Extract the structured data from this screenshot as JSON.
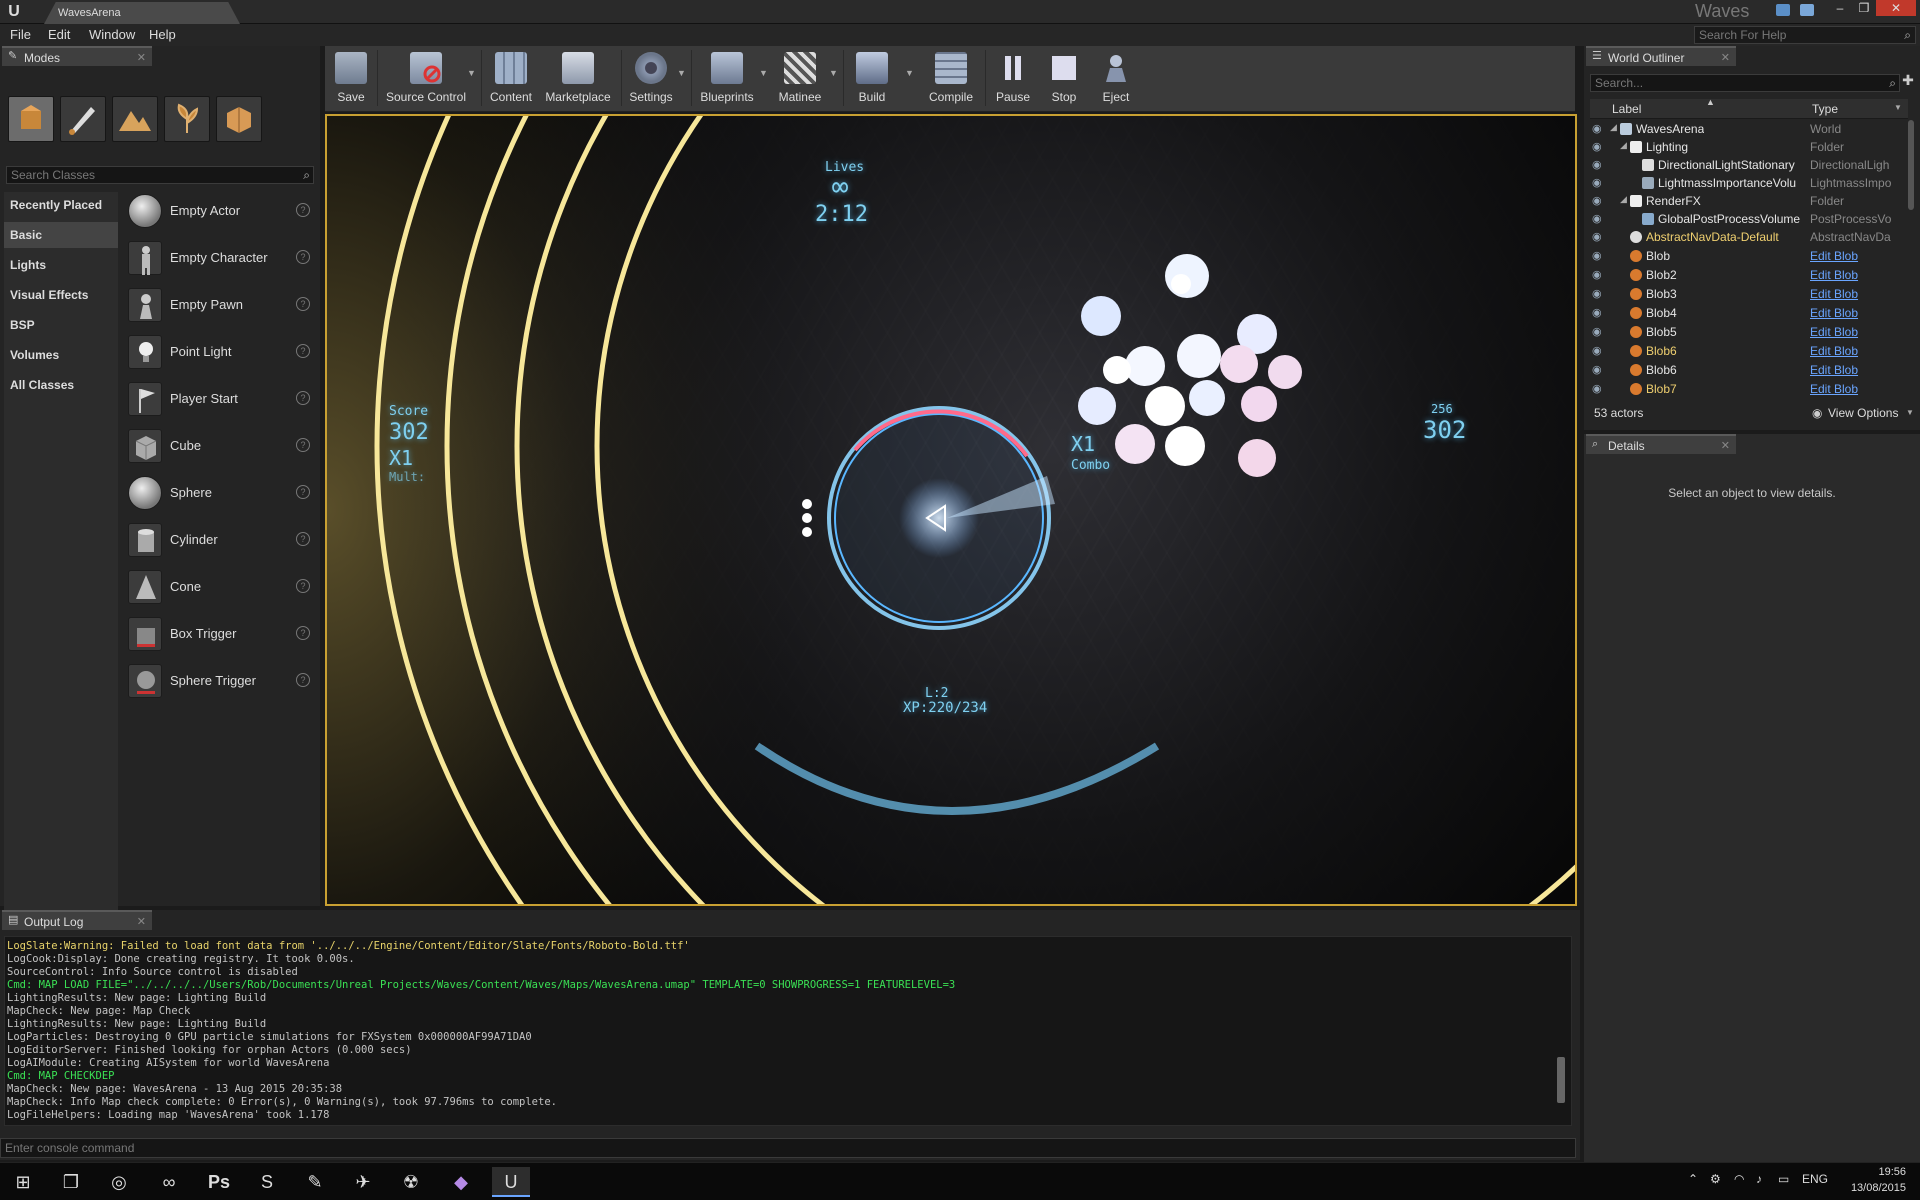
{
  "window": {
    "document_tab": "WavesArena",
    "app_title": "Waves",
    "search_help_placeholder": "Search For Help",
    "menu": [
      "File",
      "Edit",
      "Window",
      "Help"
    ]
  },
  "modes": {
    "tab_label": "Modes",
    "search_placeholder": "Search Classes",
    "categories": [
      "Recently Placed",
      "Basic",
      "Lights",
      "Visual Effects",
      "BSP",
      "Volumes",
      "All Classes"
    ],
    "active_category": "Basic",
    "classes": [
      "Empty Actor",
      "Empty Character",
      "Empty Pawn",
      "Point Light",
      "Player Start",
      "Cube",
      "Sphere",
      "Cylinder",
      "Cone",
      "Box Trigger",
      "Sphere Trigger"
    ]
  },
  "toolbar": {
    "buttons": [
      "Save",
      "Source Control",
      "Content",
      "Marketplace",
      "Settings",
      "Blueprints",
      "Matinee",
      "Build",
      "Compile",
      "Pause",
      "Stop",
      "Eject"
    ]
  },
  "game_hud": {
    "lives_label": "Lives",
    "lives_value": "∞",
    "timer": "2:12",
    "score_label": "Score",
    "score_value": "302",
    "multiplier": "X1",
    "mult_label": "Mult:",
    "combo_multiplier": "X1",
    "combo_label": "Combo",
    "right_small": "256",
    "right_score": "302",
    "level": "L:2",
    "xp": "XP:220/234"
  },
  "outliner": {
    "tab_label": "World Outliner",
    "search_placeholder": "Search...",
    "col_label": "Label",
    "col_type": "Type",
    "rows": [
      {
        "label": "WavesArena",
        "type": "World",
        "link": false
      },
      {
        "label": "Lighting",
        "type": "Folder",
        "link": false
      },
      {
        "label": "DirectionalLightStationary",
        "type": "DirectionalLigh",
        "link": false
      },
      {
        "label": "LightmassImportanceVolu",
        "type": "LightmassImpo",
        "link": false
      },
      {
        "label": "RenderFX",
        "type": "Folder",
        "link": false
      },
      {
        "label": "GlobalPostProcessVolume",
        "type": "PostProcessVo",
        "link": false
      },
      {
        "label": "AbstractNavData-Default",
        "type": "AbstractNavDa",
        "link": false
      },
      {
        "label": "Blob",
        "type": "Edit Blob",
        "link": true
      },
      {
        "label": "Blob2",
        "type": "Edit Blob",
        "link": true
      },
      {
        "label": "Blob3",
        "type": "Edit Blob",
        "link": true
      },
      {
        "label": "Blob4",
        "type": "Edit Blob",
        "link": true
      },
      {
        "label": "Blob5",
        "type": "Edit Blob",
        "link": true
      },
      {
        "label": "Blob6",
        "type": "Edit Blob",
        "link": true
      },
      {
        "label": "Blob6",
        "type": "Edit Blob",
        "link": true
      },
      {
        "label": "Blob7",
        "type": "Edit Blob",
        "link": true
      }
    ],
    "actor_count": "53 actors",
    "view_options": "View Options"
  },
  "details": {
    "tab_label": "Details",
    "empty_text": "Select an object to view details."
  },
  "output_log": {
    "tab_label": "Output Log",
    "lines": [
      {
        "text": "LogSlate:Warning: Failed to load font data from '../../../Engine/Content/Editor/Slate/Fonts/Roboto-Bold.ttf'",
        "kind": "warn"
      },
      {
        "text": "LogCook:Display: Done creating registry. It took  0.00s.",
        "kind": "normal"
      },
      {
        "text": "SourceControl: Info Source control is disabled",
        "kind": "normal"
      },
      {
        "text": "Cmd: MAP LOAD FILE=\"../../../../Users/Rob/Documents/Unreal Projects/Waves/Content/Waves/Maps/WavesArena.umap\" TEMPLATE=0 SHOWPROGRESS=1 FEATURELEVEL=3",
        "kind": "cmd"
      },
      {
        "text": "LightingResults: New page: Lighting Build",
        "kind": "normal"
      },
      {
        "text": "MapCheck: New page: Map Check",
        "kind": "normal"
      },
      {
        "text": "LightingResults: New page: Lighting Build",
        "kind": "normal"
      },
      {
        "text": "LogParticles: Destroying 0 GPU particle simulations for FXSystem 0x000000AF99A71DA0",
        "kind": "normal"
      },
      {
        "text": "LogEditorServer: Finished looking for orphan Actors (0.000 secs)",
        "kind": "normal"
      },
      {
        "text": "LogAIModule: Creating AISystem for world WavesArena",
        "kind": "normal"
      },
      {
        "text": "Cmd: MAP CHECKDEP",
        "kind": "cmd"
      },
      {
        "text": "MapCheck: New page: WavesArena - 13 Aug 2015 20:35:38",
        "kind": "normal"
      },
      {
        "text": "MapCheck: Info Map check complete: 0 Error(s), 0 Warning(s), took 97.796ms to complete.",
        "kind": "normal"
      },
      {
        "text": "LogFileHelpers: Loading map 'WavesArena' took 1.178",
        "kind": "normal"
      }
    ],
    "console_placeholder": "Enter console command"
  },
  "taskbar": {
    "language": "ENG",
    "time": "19:56",
    "date": "13/08/2015"
  }
}
